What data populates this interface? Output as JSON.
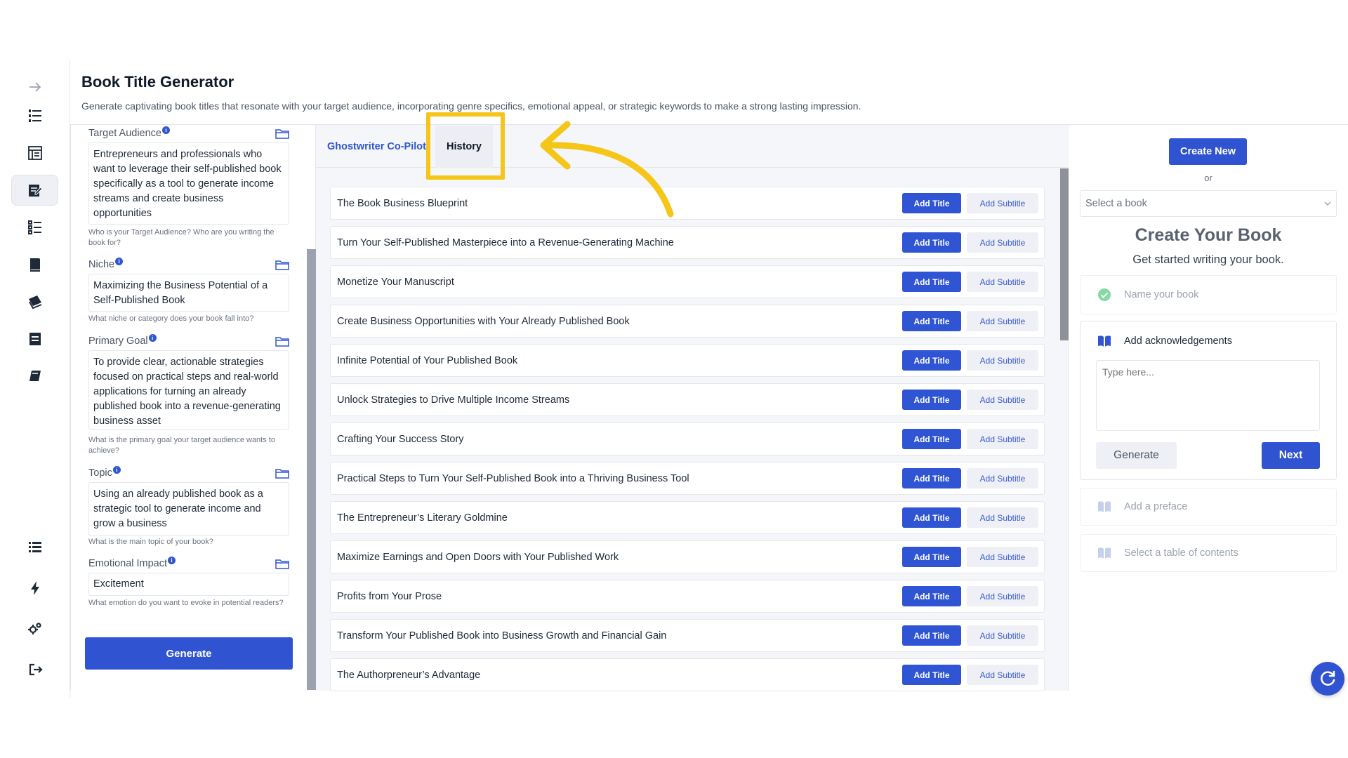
{
  "header": {
    "title": "Book Title Generator",
    "description": "Generate captivating book titles that resonate with your target audience, incorporating genre specifics, emotional appeal, or strategic keywords to make a strong lasting impression."
  },
  "sidebar": {
    "icons": [
      "arrow-right-icon",
      "list-numbered-icon",
      "document-layout-icon",
      "edit-document-icon",
      "outline-list-icon",
      "book-stack-icon",
      "books-icon",
      "archive-icon",
      "book-icon",
      "menu-list-icon",
      "lightning-icon",
      "settings-gears-icon",
      "logout-icon"
    ]
  },
  "form": {
    "info_mark": "i",
    "fields": [
      {
        "label": "Target Audience",
        "value": "Entrepreneurs and professionals who want to leverage their self-published book specifically as a tool to generate income streams and create business opportunities",
        "hint": "Who is your Target Audience? Who are you writing the book for?"
      },
      {
        "label": "Niche",
        "value": "Maximizing the Business Potential of a Self-Published Book",
        "hint": "What niche or category does your book fall into?"
      },
      {
        "label": "Primary Goal",
        "value": "To provide clear, actionable strategies focused on practical steps and real-world applications for turning an already published book into a revenue-generating business asset",
        "hint": "What is the primary goal your target audience wants to achieve?"
      },
      {
        "label": "Topic",
        "value": "Using an already published book as a strategic tool to generate income and grow a business",
        "hint": "What is the main topic of your book?"
      },
      {
        "label": "Emotional Impact",
        "value": "Excitement",
        "hint": "What emotion do you want to evoke in potential readers?"
      }
    ],
    "generate_label": "Generate"
  },
  "tabs": {
    "copilot": "Ghostwriter Co-Pilot",
    "history": "History"
  },
  "titles": {
    "add_title_label": "Add Title",
    "add_subtitle_label": "Add Subtitle",
    "items": [
      "The Book Business Blueprint",
      "Turn Your Self-Published Masterpiece into a Revenue-Generating Machine",
      "Monetize Your Manuscript",
      "Create Business Opportunities with Your Already Published Book",
      "Infinite Potential of Your Published Book",
      "Unlock Strategies to Drive Multiple Income Streams",
      "Crafting Your Success Story",
      "Practical Steps to Turn Your Self-Published Book into a Thriving Business Tool",
      "The Entrepreneur’s Literary Goldmine",
      "Maximize Earnings and Open Doors with Your Published Work",
      "Profits from Your Prose",
      "Transform Your Published Book into Business Growth and Financial Gain",
      "The Authorpreneur’s Advantage"
    ]
  },
  "right": {
    "create_new_label": "Create New",
    "or_text": "or",
    "select_placeholder": "Select a book",
    "heading": "Create Your Book",
    "subheading": "Get started writing your book.",
    "steps": {
      "name": "Name your book",
      "ack": "Add acknowledgements",
      "ack_placeholder": "Type here...",
      "generate_label": "Generate",
      "next_label": "Next",
      "preface": "Add a preface",
      "toc": "Select a table of contents"
    }
  },
  "colors": {
    "accent": "#3054d1",
    "highlight": "#f5c518",
    "success": "#86d9a6"
  }
}
